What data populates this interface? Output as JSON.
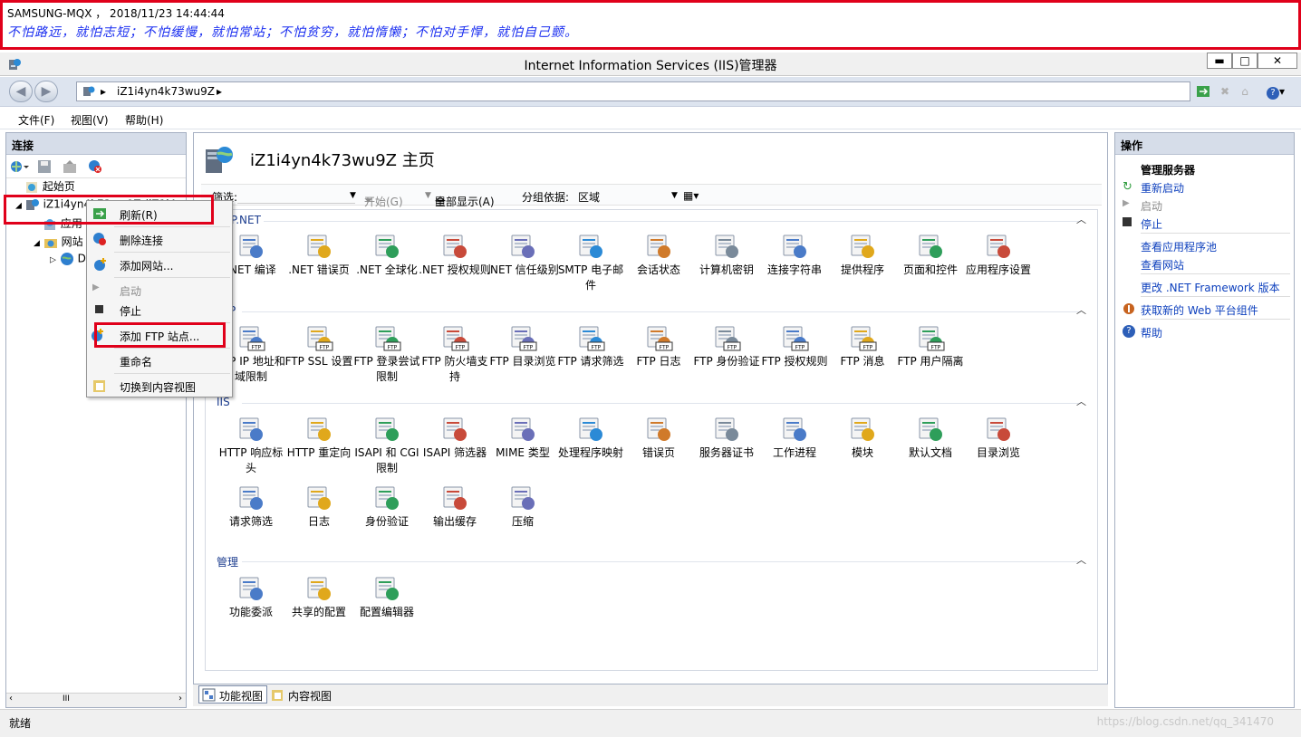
{
  "banner": {
    "line1": "SAMSUNG-MQX ， 2018/11/23 14:44:44",
    "line2": "不怕路远，就怕志短；不怕缓慢，就怕常站；不怕贫穷，就怕惰懒；不怕对手悍，就怕自己颤。"
  },
  "window": {
    "title": "Internet Information Services (IIS)管理器",
    "minimize": "▬",
    "maximize": "□",
    "close": "✕"
  },
  "address": {
    "crumb": "iZ1i4yn4k73wu9Z"
  },
  "menu": [
    "文件(F)",
    "视图(V)",
    "帮助(H)"
  ],
  "connections": {
    "header": "连接",
    "tree": {
      "start_page": "起始页",
      "server": "iZ1i4yn4k73wu9Z (iZ1i4...",
      "app_pools": "应用",
      "sites": "网站",
      "default_site": "D"
    },
    "scroll_mid": "III"
  },
  "context_menu": {
    "refresh": "刷新(R)",
    "remove_connection": "删除连接",
    "add_website": "添加网站...",
    "start": "启动",
    "stop": "停止",
    "add_ftp_site": "添加 FTP 站点...",
    "rename": "重命名",
    "switch_content_view": "切换到内容视图"
  },
  "center": {
    "title": "iZ1i4yn4k73wu9Z 主页",
    "filter_label": "筛选:",
    "start_label": "开始(G)",
    "show_all_label": "全部显示(A)",
    "group_by_label": "分组依据:",
    "group_by_value": "区域",
    "groups": {
      "aspnet": "ASP.NET",
      "ftp": "FTP",
      "iis": "IIS",
      "manage": "管理"
    },
    "aspnet_tiles": [
      ".NET 编译",
      ".NET 错误页",
      ".NET 全球化",
      ".NET 授权规则",
      ".NET 信任级别",
      "SMTP 电子邮件",
      "会话状态",
      "计算机密钥",
      "连接字符串",
      "提供程序",
      "页面和控件",
      "应用程序设置"
    ],
    "ftp_tiles": [
      "FTP IP 地址和域限制",
      "FTP SSL 设置",
      "FTP 登录尝试限制",
      "FTP 防火墙支持",
      "FTP 目录浏览",
      "FTP 请求筛选",
      "FTP 日志",
      "FTP 身份验证",
      "FTP 授权规则",
      "FTP 消息",
      "FTP 用户隔离"
    ],
    "iis_tiles_row1": [
      "HTTP 响应标头",
      "HTTP 重定向",
      "ISAPI 和 CGI 限制",
      "ISAPI 筛选器",
      "MIME 类型",
      "处理程序映射",
      "错误页",
      "服务器证书",
      "工作进程",
      "模块",
      "默认文档",
      "目录浏览"
    ],
    "iis_tiles_row2": [
      "请求筛选",
      "日志",
      "身份验证",
      "输出缓存",
      "压缩"
    ],
    "manage_tiles": [
      "功能委派",
      "共享的配置",
      "配置编辑器"
    ],
    "feature_view": "功能视图",
    "content_view": "内容视图"
  },
  "actions": {
    "header": "操作",
    "manage_server": "管理服务器",
    "restart": "重新启动",
    "start": "启动",
    "stop": "停止",
    "view_app_pools": "查看应用程序池",
    "view_sites": "查看网站",
    "change_net": "更改 .NET Framework 版本",
    "get_web_platform": "获取新的 Web 平台组件",
    "help": "帮助"
  },
  "status": {
    "text": "就绪",
    "watermark": "https://blog.csdn.net/qq_341470"
  }
}
